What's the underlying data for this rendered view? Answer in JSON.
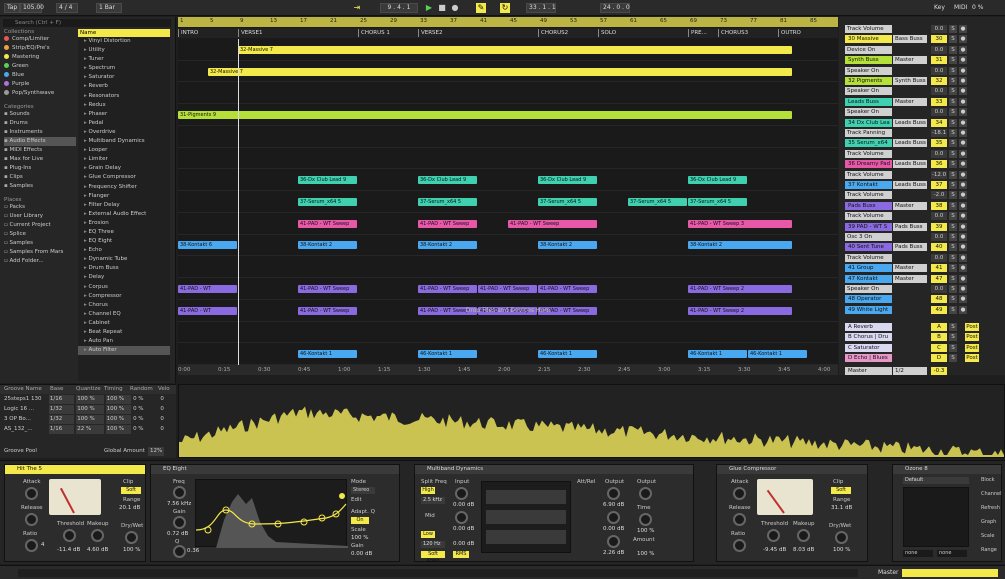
{
  "transport": {
    "tap": "Tap",
    "tempo": "105.00",
    "signature": "4 / 4",
    "quantize": "1 Bar",
    "position": "9 . 4 . 1",
    "loop_start": "33 . 1 . 1",
    "loop_length": "24 . 0 . 0",
    "key": "Key",
    "midi": "MIDI",
    "cpu": "0 %"
  },
  "browser": {
    "search_placeholder": "Search (Ctrl + F)",
    "collections_header": "Collections",
    "collections": [
      {
        "label": "Comp/Limiter",
        "color": "#e85858"
      },
      {
        "label": "Strip/EQ/Pre's",
        "color": "#f0a040"
      },
      {
        "label": "Mastering",
        "color": "#f4e94a"
      },
      {
        "label": "Green",
        "color": "#58d058"
      },
      {
        "label": "Blue",
        "color": "#4aa8f0"
      },
      {
        "label": "Purple",
        "color": "#b070e0"
      },
      {
        "label": "Pop/Synthwave",
        "color": "#9a9a9a"
      }
    ],
    "categories_header": "Categories",
    "categories": [
      "Sounds",
      "Drums",
      "Instruments",
      "Audio Effects",
      "MIDI Effects",
      "Max for Live",
      "Plug-Ins",
      "Clips",
      "Samples"
    ],
    "places_header": "Places",
    "places": [
      "Packs",
      "User Library",
      "Current Project",
      "Splice",
      "Samples",
      "Samples From Mars",
      "Add Folder..."
    ],
    "items_header": "Name",
    "items": [
      "Vinyl Distortion",
      "Utility",
      "Tuner",
      "Spectrum",
      "Saturator",
      "Reverb",
      "Resonators",
      "Redux",
      "Phaser",
      "Pedal",
      "Overdrive",
      "Multiband Dynamics",
      "Looper",
      "Limiter",
      "Grain Delay",
      "Glue Compressor",
      "Frequency Shifter",
      "Flanger",
      "Filter Delay",
      "External Audio Effect",
      "Erosion",
      "EQ Three",
      "EQ Eight",
      "Echo",
      "Dynamic Tube",
      "Drum Buss",
      "Delay",
      "Corpus",
      "Compressor",
      "Chorus",
      "Channel EQ",
      "Cabinet",
      "Beat Repeat",
      "Auto Pan",
      "Auto Filter"
    ]
  },
  "groove": {
    "headers": [
      "Groove Name",
      "Base",
      "Quantize",
      "Timing",
      "Random",
      "Velo"
    ],
    "rows": [
      [
        "25steps1 130",
        "1/16",
        "100 %",
        "100 %",
        "0 %",
        "0"
      ],
      [
        "Logic 16 ...",
        "1/32",
        "100 %",
        "100 %",
        "0 %",
        "0"
      ],
      [
        "3 OP Bo...",
        "1/32",
        "100 %",
        "100 %",
        "0 %",
        "0"
      ],
      [
        "AS_132_...",
        "1/16",
        "22 %",
        "100 %",
        "0 %",
        "0"
      ]
    ],
    "pool_label": "Groove Pool",
    "global_label": "Global Amount",
    "global_value": "12%"
  },
  "arrangement": {
    "ruler": [
      "1",
      "5",
      "9",
      "13",
      "17",
      "21",
      "25",
      "29",
      "33",
      "37",
      "41",
      "45",
      "49",
      "53",
      "57",
      "61",
      "65",
      "69",
      "73",
      "77",
      "81",
      "85",
      "89"
    ],
    "locators": [
      {
        "label": "INTRO",
        "pos": 0
      },
      {
        "label": "VERSE1",
        "pos": 8
      },
      {
        "label": "CHORUS 1",
        "pos": 24
      },
      {
        "label": "VERSE2",
        "pos": 32
      },
      {
        "label": "CHORUS2",
        "pos": 48
      },
      {
        "label": "SOLO",
        "pos": 56
      },
      {
        "label": "PRE...",
        "pos": 68
      },
      {
        "label": "CHORUS3",
        "pos": 72
      },
      {
        "label": "OUTRO",
        "pos": 80
      }
    ],
    "drop_hint": "Drop Files and Devices Here",
    "times": [
      "0:00",
      "0:15",
      "0:30",
      "0:45",
      "1:00",
      "1:15",
      "1:30",
      "1:45",
      "2:00",
      "2:15",
      "2:30",
      "2:45",
      "3:00",
      "3:15",
      "3:30",
      "3:45",
      "4:00"
    ],
    "lanes": [
      {
        "color": "#f4e94a",
        "clips": [
          {
            "s": 8,
            "e": 82,
            "t": "32-Massive 7"
          }
        ]
      },
      {
        "color": "#f4e94a",
        "clips": [
          {
            "s": 4,
            "e": 82,
            "t": "32-Massive 7"
          }
        ]
      },
      {
        "color": "",
        "clips": []
      },
      {
        "color": "#b5e03a",
        "clips": [
          {
            "s": 0,
            "e": 82,
            "t": "31-Pigments 9"
          }
        ]
      },
      {
        "color": "",
        "clips": []
      },
      {
        "color": "",
        "clips": []
      },
      {
        "color": "#3fd0b0",
        "clips": [
          {
            "s": 16,
            "e": 24,
            "t": "36-Dx Club Lead 9"
          },
          {
            "s": 32,
            "e": 40,
            "t": "36-Dx Club Lead 9"
          },
          {
            "s": 48,
            "e": 56,
            "t": "36-Dx Club Lead 9"
          },
          {
            "s": 68,
            "e": 76,
            "t": "36-Dx Club Lead 9"
          }
        ]
      },
      {
        "color": "#3fd0b0",
        "clips": [
          {
            "s": 16,
            "e": 24,
            "t": "37-Serum_x64 5"
          },
          {
            "s": 32,
            "e": 40,
            "t": "37-Serum_x64 5"
          },
          {
            "s": 48,
            "e": 56,
            "t": "37-Serum_x64 5"
          },
          {
            "s": 60,
            "e": 68,
            "t": "37-Serum_x64 5"
          },
          {
            "s": 68,
            "e": 76,
            "t": "37-Serum_x64 5"
          }
        ]
      },
      {
        "color": "#e858a8",
        "clips": [
          {
            "s": 16,
            "e": 24,
            "t": "41-PAD - WT Sweep"
          },
          {
            "s": 32,
            "e": 40,
            "t": "41-PAD - WT Sweep"
          },
          {
            "s": 44,
            "e": 56,
            "t": "41-PAD - WT Sweep"
          },
          {
            "s": 68,
            "e": 82,
            "t": "41-PAD - WT Sweep 3"
          }
        ]
      },
      {
        "color": "#4aa8f0",
        "clips": [
          {
            "s": 0,
            "e": 8,
            "t": "38-Kontakt 6"
          },
          {
            "s": 16,
            "e": 24,
            "t": "38-Kontakt 2"
          },
          {
            "s": 32,
            "e": 40,
            "t": "38-Kontakt 2"
          },
          {
            "s": 48,
            "e": 56,
            "t": "38-Kontakt 2"
          },
          {
            "s": 68,
            "e": 82,
            "t": "38-Kontakt 2"
          }
        ]
      },
      {
        "color": "",
        "clips": []
      },
      {
        "color": "#8a6ae0",
        "clips": [
          {
            "s": 0,
            "e": 8,
            "t": "41-PAD - WT"
          },
          {
            "s": 16,
            "e": 24,
            "t": "41-PAD - WT Sweep"
          },
          {
            "s": 32,
            "e": 40,
            "t": "41-PAD - WT Sweep"
          },
          {
            "s": 40,
            "e": 48,
            "t": "41-PAD - WT Sweep"
          },
          {
            "s": 48,
            "e": 56,
            "t": "41-PAD - WT Sweep"
          },
          {
            "s": 68,
            "e": 82,
            "t": "41-PAD - WT Sweep 2"
          }
        ]
      },
      {
        "color": "#8a6ae0",
        "clips": [
          {
            "s": 0,
            "e": 8,
            "t": "41-PAD - WT"
          },
          {
            "s": 16,
            "e": 24,
            "t": "41-PAD - WT Sweep"
          },
          {
            "s": 32,
            "e": 40,
            "t": "41-PAD - WT Sweep"
          },
          {
            "s": 40,
            "e": 48,
            "t": "41-PAD - WT Sweep"
          },
          {
            "s": 48,
            "e": 56,
            "t": "41-PAD - WT Sweep"
          },
          {
            "s": 68,
            "e": 82,
            "t": "41-PAD - WT Sweep 2"
          }
        ]
      },
      {
        "color": "",
        "clips": []
      },
      {
        "color": "#4aa8f0",
        "clips": [
          {
            "s": 16,
            "e": 24,
            "t": "46-Kontakt 1"
          },
          {
            "s": 32,
            "e": 40,
            "t": "46-Kontakt 1"
          },
          {
            "s": 48,
            "e": 56,
            "t": "46-Kontakt 1"
          },
          {
            "s": 68,
            "e": 76,
            "t": "46-Kontakt 1"
          },
          {
            "s": 76,
            "e": 84,
            "t": "46-Kontakt 1"
          }
        ]
      }
    ]
  },
  "mixer": {
    "tracks": [
      {
        "name": "Track Volume",
        "kind": "sub",
        "route": "",
        "num": "",
        "vol": "0.0"
      },
      {
        "name": "30 Massive",
        "kind": "track",
        "color": "#f4e94a",
        "route": "Bass Buss",
        "num": "30",
        "vol": "0.0"
      },
      {
        "name": "Device On",
        "kind": "sub",
        "route": "",
        "num": "",
        "vol": "0.0"
      },
      {
        "name": "Synth Buss",
        "kind": "track",
        "color": "#b5e03a",
        "route": "Master",
        "num": "31",
        "vol": "0.0"
      },
      {
        "name": "Speaker On",
        "kind": "sub",
        "route": "",
        "num": "",
        "vol": "0.0"
      },
      {
        "name": "32 Pigments",
        "kind": "track",
        "color": "#b5e03a",
        "route": "Synth Buss",
        "num": "32",
        "vol": "-12.0"
      },
      {
        "name": "Speaker On",
        "kind": "sub",
        "route": "",
        "num": "",
        "vol": "0.0"
      },
      {
        "name": "Leads Buss",
        "kind": "track",
        "color": "#3fd0b0",
        "route": "Master",
        "num": "33",
        "vol": "0.0"
      },
      {
        "name": "Speaker On",
        "kind": "sub",
        "route": "",
        "num": "",
        "vol": "0.0"
      },
      {
        "name": "34 Dx Club Lea",
        "kind": "track",
        "color": "#3fd0b0",
        "route": "Leads Buss",
        "num": "34",
        "vol": "0.0"
      },
      {
        "name": "Track Panning",
        "kind": "sub",
        "route": "",
        "num": "",
        "vol": "-18.1"
      },
      {
        "name": "35 Serum_x64",
        "kind": "track",
        "color": "#3fd0b0",
        "route": "Leads Buss",
        "num": "35",
        "vol": "-12.0"
      },
      {
        "name": "Track Volume",
        "kind": "sub",
        "route": "",
        "num": "",
        "vol": "0.0"
      },
      {
        "name": "36 Dreamy Pad",
        "kind": "track",
        "color": "#e858a8",
        "route": "Leads Buss",
        "num": "36",
        "vol": "0.0"
      },
      {
        "name": "Track Volume",
        "kind": "sub",
        "route": "",
        "num": "",
        "vol": "-12.0"
      },
      {
        "name": "37 Kontakt",
        "kind": "track",
        "color": "#4aa8f0",
        "route": "Leads Buss",
        "num": "37",
        "vol": "0.0"
      },
      {
        "name": "Track Volume",
        "kind": "sub",
        "route": "",
        "num": "",
        "vol": "-2.0"
      },
      {
        "name": "Pads Buss",
        "kind": "track",
        "color": "#8a6ae0",
        "route": "Master",
        "num": "38",
        "vol": "0.0"
      },
      {
        "name": "Track Volume",
        "kind": "sub",
        "route": "",
        "num": "",
        "vol": "0.0"
      },
      {
        "name": "39 PAD - WT S",
        "kind": "track",
        "color": "#8a6ae0",
        "route": "Pads Buss",
        "num": "39",
        "vol": "0.0"
      },
      {
        "name": "Osc 3 On",
        "kind": "sub",
        "route": "",
        "num": "",
        "vol": "0.0"
      },
      {
        "name": "40 Sent Tune",
        "kind": "track",
        "color": "#8a6ae0",
        "route": "Pads Buss",
        "num": "40",
        "vol": "-6.0"
      },
      {
        "name": "Track Volume",
        "kind": "sub",
        "route": "",
        "num": "",
        "vol": "0.0"
      },
      {
        "name": "41 Group",
        "kind": "track",
        "color": "#4aa8f0",
        "route": "Master",
        "num": "41",
        "vol": "0.0"
      },
      {
        "name": "47 Kontakt",
        "kind": "track",
        "color": "#4aa8f0",
        "route": "Master",
        "num": "47",
        "vol": "0.0"
      },
      {
        "name": "Speaker On",
        "kind": "sub",
        "route": "",
        "num": "",
        "vol": "0.0"
      },
      {
        "name": "48 Operator",
        "kind": "track",
        "color": "#4aa8f0",
        "route": "",
        "num": "48",
        "vol": "0.0"
      },
      {
        "name": "49 White Light",
        "kind": "track",
        "color": "#4aa8f0",
        "route": "",
        "num": "49",
        "vol": "0.0"
      }
    ],
    "returns": [
      {
        "name": "A Reverb",
        "color": "#d8d8f0",
        "num": "A",
        "post": "Post"
      },
      {
        "name": "B Chorus | Dru",
        "color": "#d8d8f0",
        "num": "B",
        "post": "Post"
      },
      {
        "name": "C Saturator",
        "color": "#d8d8f0",
        "num": "C",
        "post": "Post"
      },
      {
        "name": "D Echo | Blues",
        "color": "#e898c8",
        "num": "D",
        "post": "Post"
      }
    ],
    "master": {
      "name": "Master",
      "route": "1/2",
      "vol": "-0.3"
    }
  },
  "devices": {
    "hitthe5": {
      "title": "Hit The 5",
      "attack_lbl": "Attack",
      "release_lbl": "Release",
      "ratio_lbl": "Ratio",
      "ratio": "4",
      "threshold_lbl": "Threshold",
      "threshold": "-11.4 dB",
      "makeup_lbl": "Makeup",
      "makeup": "4.60 dB",
      "range_lbl": "Range",
      "range": "20.1 dB",
      "drywet_lbl": "Dry/Wet",
      "drywet": "100 %",
      "clip_lbl": "Clip",
      "soft": "Soft"
    },
    "eq": {
      "title": "EQ Eight",
      "freq_lbl": "Freq",
      "freq": "7.56 kHz",
      "gain_lbl": "Gain",
      "gain": "0.72 dB",
      "q_lbl": "Q",
      "q": "0.36",
      "mode_lbl": "Mode",
      "stereo": "Stereo",
      "edit_lbl": "Edit",
      "adapt_lbl": "Adapt. Q",
      "on": "On",
      "scale_lbl": "Scale",
      "scale": "100 %",
      "gain2_lbl": "Gain",
      "gain2": "0.00 dB"
    },
    "mb": {
      "title": "Multiband Dynamics",
      "split_lbl": "Split Freq",
      "high": "High",
      "high_val": "2.5 kHz",
      "low": "Low",
      "low_val": "120 Hz",
      "input_lbl": "Input",
      "input": "0.00 dB",
      "mid_lbl": "Mid",
      "mid_in": "0.00 dB",
      "low_in": "0.00 dB",
      "soft_knee": "Soft Knee",
      "rms": "RMS",
      "output_lbl": "Output",
      "out_h": "6.90 dB",
      "out_m": "0.00 dB",
      "out_l": "2.26 dB",
      "time_lbl": "Time",
      "time": "100 %",
      "amount_lbl": "Amount",
      "amount": "100 %",
      "attrel": "Att/Rel"
    },
    "glue": {
      "title": "Glue Compressor",
      "attack_lbl": "Attack",
      "release_lbl": "Release",
      "ratio_lbl": "Ratio",
      "threshold_lbl": "Threshold",
      "threshold": "-9.45 dB",
      "makeup_lbl": "Makeup",
      "makeup": "8.03 dB",
      "range_lbl": "Range",
      "range": "31.1 dB",
      "drywet_lbl": "Dry/Wet",
      "drywet": "100 %",
      "clip_lbl": "Clip",
      "soft": "Soft"
    },
    "ozone": {
      "title": "Ozone 8",
      "preset": "Default",
      "none1": "none",
      "none2": "none",
      "side": [
        "Block",
        "Channel",
        "Refresh",
        "Graph",
        "Scale",
        "Range"
      ],
      "avg": "Avg"
    }
  },
  "status": {
    "master": "Master"
  }
}
